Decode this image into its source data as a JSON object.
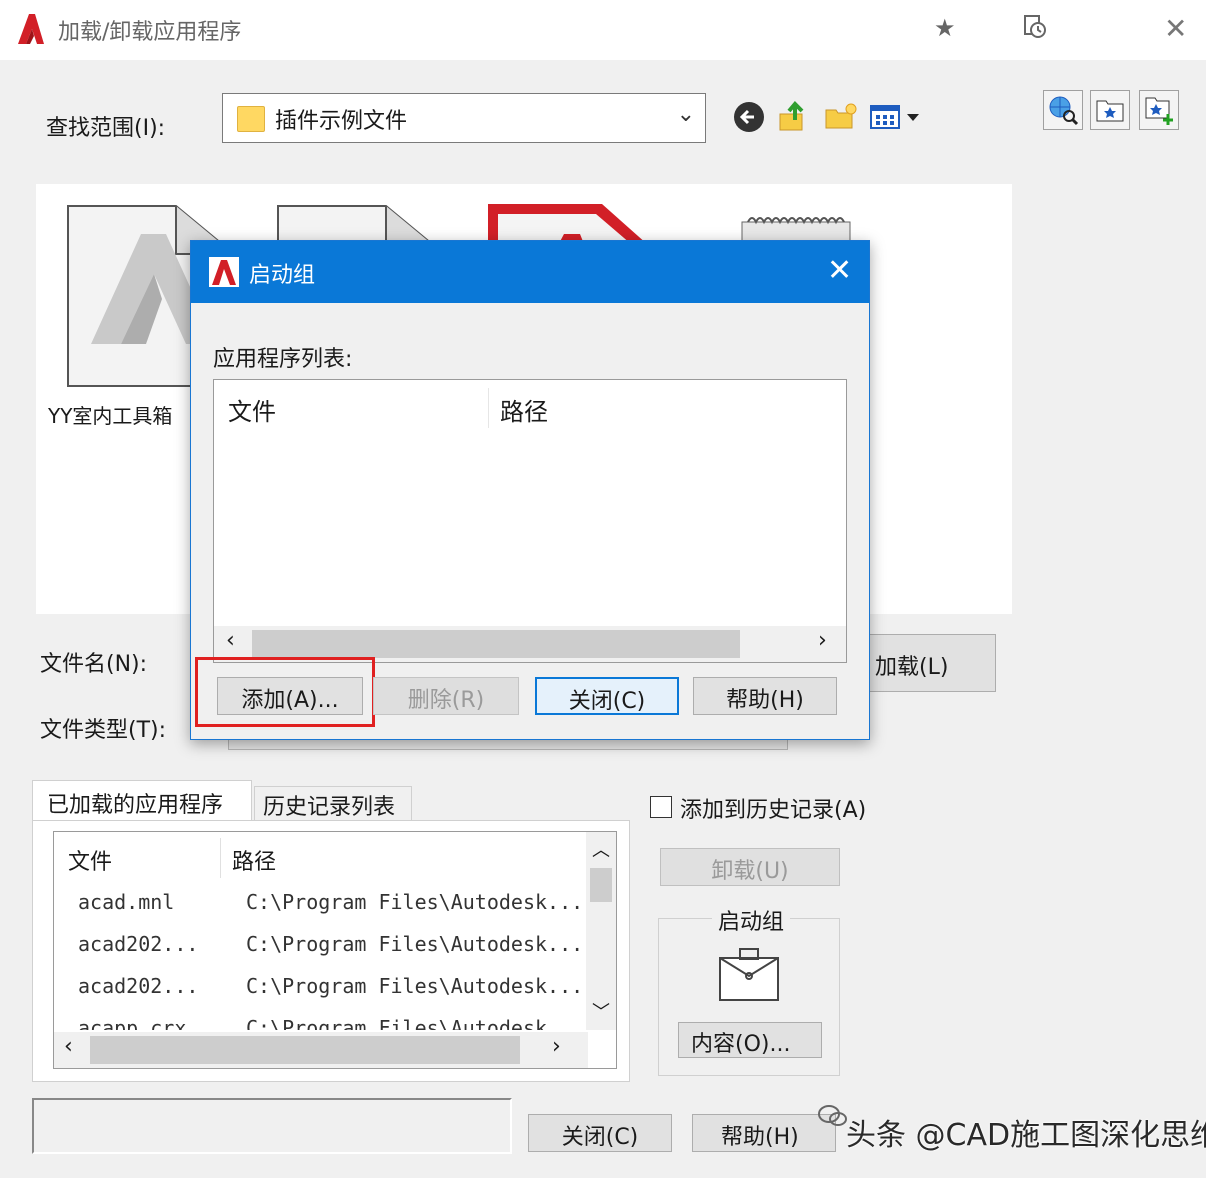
{
  "window": {
    "title": "加载/卸载应用程序",
    "brand_color": "#d21f27",
    "icons": [
      "app-logo-icon",
      "star-icon",
      "history-icon",
      "close-icon"
    ]
  },
  "lookin": {
    "label": "查找范围(I):",
    "value": "插件示例文件"
  },
  "toolbar": {
    "icons": [
      "back-icon",
      "up-folder-icon",
      "new-folder-icon",
      "views-menu-icon",
      "search-web-icon",
      "favorites-icon",
      "add-to-favorites-icon"
    ]
  },
  "files": {
    "items": [
      {
        "label": "YY室内工具箱"
      }
    ]
  },
  "form": {
    "filename_label": "文件名(N):",
    "filetype_label": "文件类型(T):",
    "load_button": "加载(L)"
  },
  "tabs": {
    "loaded": "已加载的应用程序",
    "history": "历史记录列表"
  },
  "loaded_list": {
    "columns": [
      "文件",
      "路径"
    ],
    "rows": [
      {
        "file": "acad.mnl",
        "path": "C:\\Program Files\\Autodesk..."
      },
      {
        "file": "acad202...",
        "path": "C:\\Program Files\\Autodesk..."
      },
      {
        "file": "acad202...",
        "path": "C:\\Program Files\\Autodesk..."
      },
      {
        "file": "acapp.crx",
        "path": "C:\\Program Files\\Autodesk"
      }
    ]
  },
  "side": {
    "add_history_label": "添加到历史记录(A)",
    "add_history_checked": false,
    "unload_button": "卸载(U)",
    "startup_group_title": "启动组",
    "contents_button": "内容(O)..."
  },
  "footer": {
    "close_button": "关闭(C)",
    "help_button": "帮助(H)",
    "watermark": "头条 @CAD施工图深化思维"
  },
  "dialog": {
    "title": "启动组",
    "list_label": "应用程序列表:",
    "columns": [
      "文件",
      "路径"
    ],
    "add_button": "添加(A)...",
    "remove_button": "删除(R)",
    "close_button": "关闭(C)",
    "help_button": "帮助(H)",
    "titlebar_color": "#0a78d7",
    "highlight_color": "#e02020"
  }
}
